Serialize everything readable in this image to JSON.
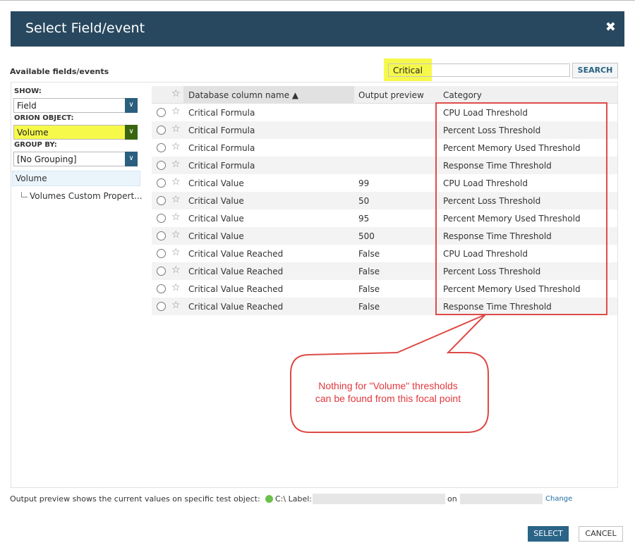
{
  "dialog": {
    "title": "Select Field/event",
    "close_icon": "✖"
  },
  "available_label": "Available fields/events",
  "search": {
    "value": "Critical",
    "placeholder": "",
    "button_label": "SEARCH",
    "highlight_color": "#f6f94a"
  },
  "filters": {
    "show_label": "SHOW:",
    "show_value": "Field",
    "object_label": "ORION OBJECT:",
    "object_value": "Volume",
    "group_label": "GROUP BY:",
    "group_value": "[No Grouping]"
  },
  "tree": {
    "root": "Volume",
    "child": "Volumes Custom Propert..."
  },
  "grid": {
    "columns": [
      "Database column name ▲",
      "Output preview",
      "Category"
    ],
    "rows": [
      {
        "name": "Critical Formula",
        "preview": "",
        "category": "CPU Load Threshold"
      },
      {
        "name": "Critical Formula",
        "preview": "",
        "category": "Percent Loss Threshold"
      },
      {
        "name": "Critical Formula",
        "preview": "",
        "category": "Percent Memory Used Threshold"
      },
      {
        "name": "Critical Formula",
        "preview": "",
        "category": "Response Time Threshold"
      },
      {
        "name": "Critical Value",
        "preview": "99",
        "category": "CPU Load Threshold"
      },
      {
        "name": "Critical Value",
        "preview": "50",
        "category": "Percent Loss Threshold"
      },
      {
        "name": "Critical Value",
        "preview": "95",
        "category": "Percent Memory Used Threshold"
      },
      {
        "name": "Critical Value",
        "preview": "500",
        "category": "Response Time Threshold"
      },
      {
        "name": "Critical Value Reached",
        "preview": "False",
        "category": "CPU Load Threshold"
      },
      {
        "name": "Critical Value Reached",
        "preview": "False",
        "category": "Percent Loss Threshold"
      },
      {
        "name": "Critical Value Reached",
        "preview": "False",
        "category": "Percent Memory Used Threshold"
      },
      {
        "name": "Critical Value Reached",
        "preview": "False",
        "category": "Response Time Threshold"
      }
    ]
  },
  "annotation": {
    "line1": "Nothing for \"Volume\" thresholds",
    "line2": "can be found from this focal point",
    "color": "#e0393e"
  },
  "footer": {
    "preview_text": "Output preview shows the current values on specific test object:",
    "object_label": "C:\\ Label:",
    "on_text": "on",
    "change_link": "Change",
    "select_button": "SELECT",
    "cancel_button": "CANCEL"
  },
  "colors": {
    "header_bg": "#28485f",
    "accent": "#2a6487",
    "status_ok": "#6cc04a"
  }
}
